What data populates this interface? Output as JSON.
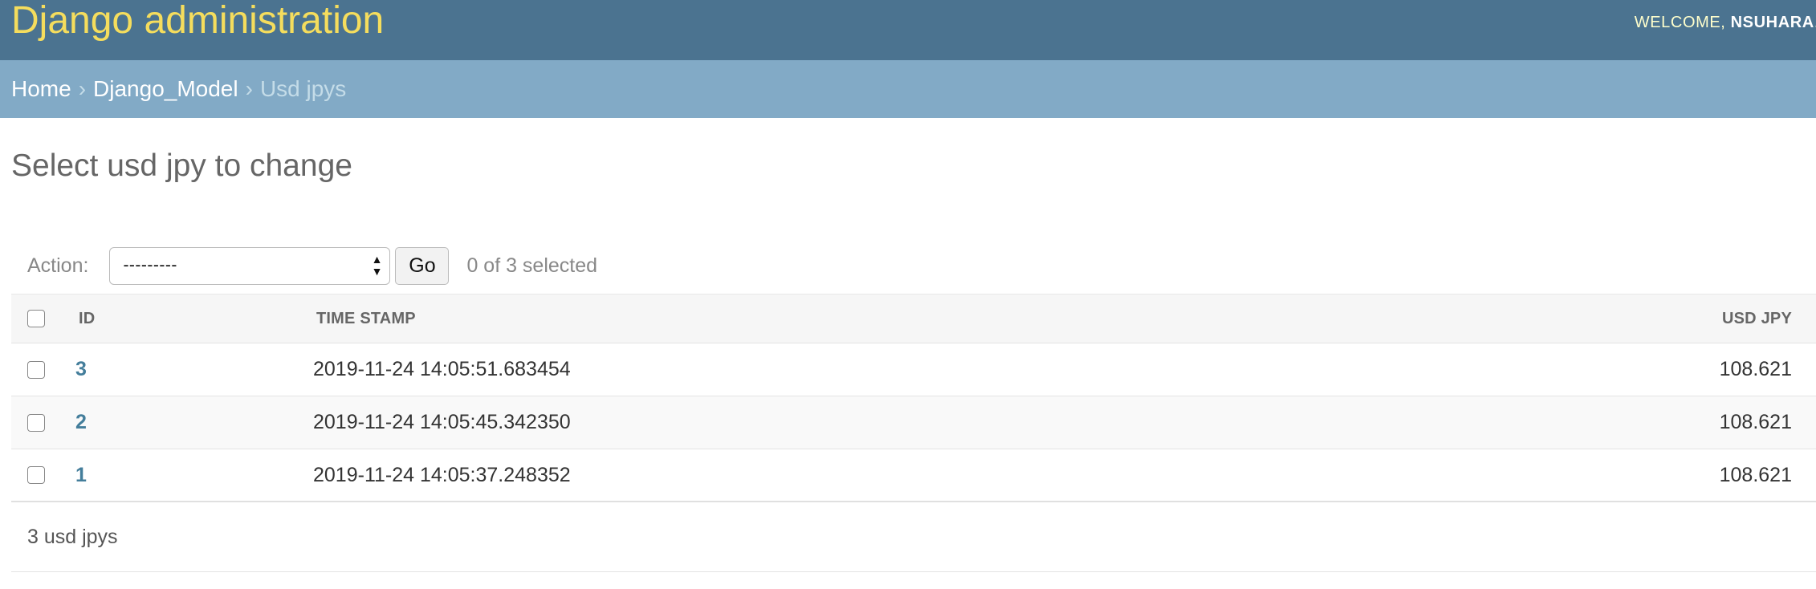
{
  "header": {
    "site_title": "Django administration",
    "welcome_text": "WELCOME, ",
    "username": "NSUHARA",
    "username_suffix": ".",
    "colors": {
      "header_bg": "#4b7390",
      "title": "#f5dd5d",
      "breadcrumb_bg": "#82aac6",
      "link": "#447e9b"
    }
  },
  "breadcrumbs": {
    "home": "Home",
    "app": "Django_Model",
    "current": "Usd jpys",
    "separator": "›"
  },
  "page": {
    "title": "Select usd jpy to change"
  },
  "actions": {
    "label": "Action:",
    "selected_option": "---------",
    "go_label": "Go",
    "counter": "0 of 3 selected",
    "select_icon": "up-down-arrows-icon"
  },
  "table": {
    "columns": {
      "id": "ID",
      "time_stamp": "TIME STAMP",
      "usd_jpy": "USD JPY"
    },
    "rows": [
      {
        "id": "3",
        "time_stamp": "2019-11-24 14:05:51.683454",
        "usd_jpy": "108.621"
      },
      {
        "id": "2",
        "time_stamp": "2019-11-24 14:05:45.342350",
        "usd_jpy": "108.621"
      },
      {
        "id": "1",
        "time_stamp": "2019-11-24 14:05:37.248352",
        "usd_jpy": "108.621"
      }
    ]
  },
  "paginator": {
    "count_text": "3 usd jpys"
  }
}
